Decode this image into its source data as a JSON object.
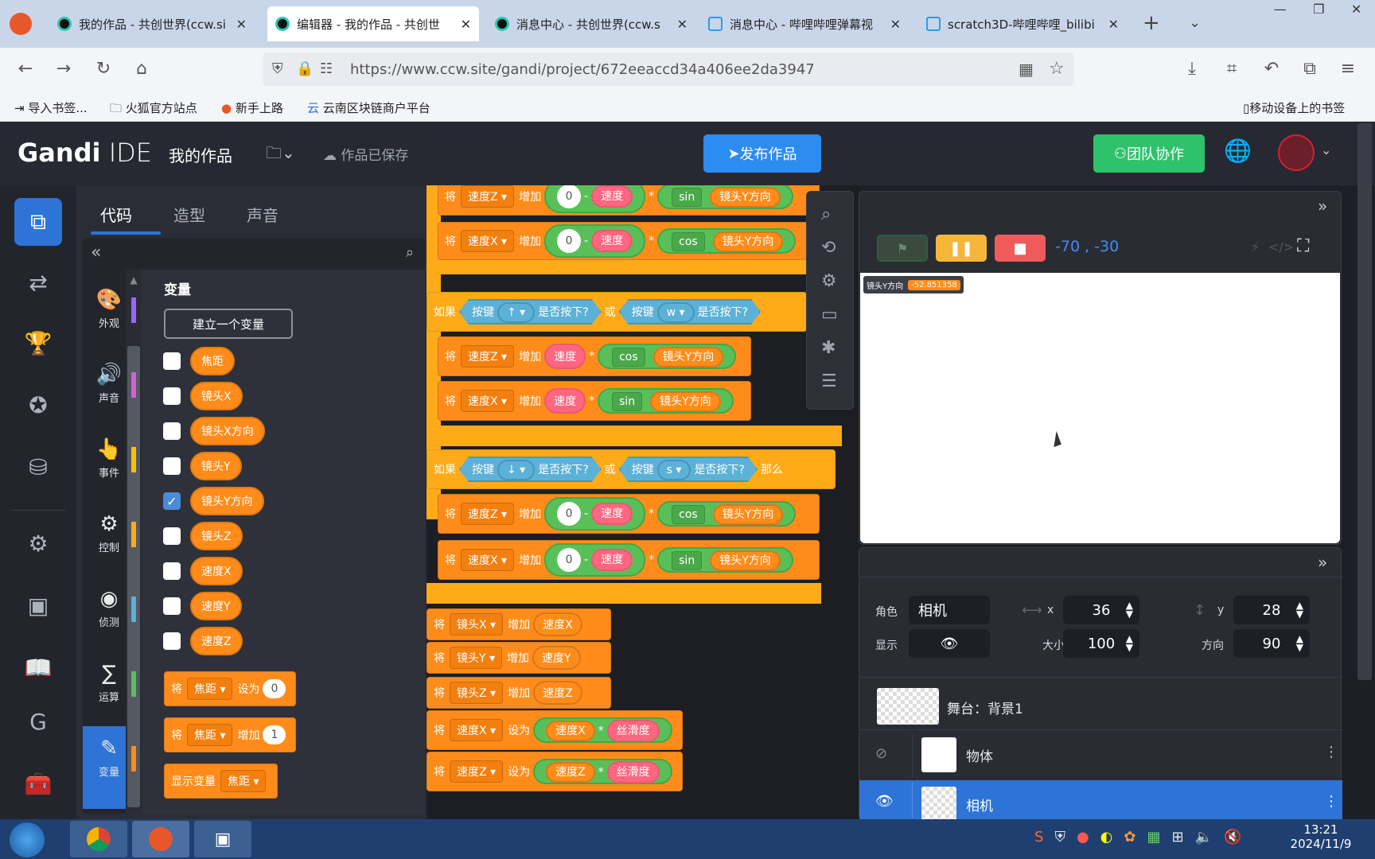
{
  "browser": {
    "tabs": [
      {
        "label": "我的作品 - 共创世界(ccw.si",
        "type": "ccw"
      },
      {
        "label": "编辑器 - 我的作品 - 共创世",
        "type": "ccw",
        "active": true
      },
      {
        "label": "消息中心 - 共创世界(ccw.s",
        "type": "ccw"
      },
      {
        "label": "消息中心 - 哔哩哔哩弹幕视",
        "type": "bili"
      },
      {
        "label": "scratch3D-哔哩哔哩_bilibi",
        "type": "bili"
      }
    ],
    "url": "https://www.ccw.site/gandi/project/672eeaccd34a406ee2da3947",
    "bookmarks": [
      "导入书签...",
      "火狐官方站点",
      "新手上路",
      "云南区块链商户平台"
    ],
    "mobile_bookmarks": "移动设备上的书签"
  },
  "app": {
    "logo_bold": "Gandi",
    "logo_light": "IDE",
    "project_name": "我的作品",
    "save_status": "作品已保存",
    "publish_label": "发布作品",
    "team_label": "团队协作"
  },
  "code_tabs": [
    "代码",
    "造型",
    "声音"
  ],
  "categories": [
    {
      "label": "外观",
      "color": "#9966ff",
      "icon": "palette-icon",
      "glyph": "🎨"
    },
    {
      "label": "声音",
      "color": "#cf63cf",
      "icon": "speaker-icon",
      "glyph": "🔊"
    },
    {
      "label": "事件",
      "color": "#ffbf00",
      "icon": "pointer-icon",
      "glyph": "👆"
    },
    {
      "label": "控制",
      "color": "#ffab19",
      "icon": "flow-icon",
      "glyph": "⚙"
    },
    {
      "label": "侦测",
      "color": "#5cb1d6",
      "icon": "signal-icon",
      "glyph": "◉"
    },
    {
      "label": "运算",
      "color": "#59c059",
      "icon": "math-icon",
      "glyph": "∑"
    },
    {
      "label": "变量",
      "color": "#ff8c1a",
      "icon": "variable-icon",
      "glyph": "✎"
    }
  ],
  "palette": {
    "section_title": "变量",
    "make_variable": "建立一个变量",
    "variables": [
      {
        "name": "焦距",
        "checked": false
      },
      {
        "name": "镜头X",
        "checked": false
      },
      {
        "name": "镜头X方向",
        "checked": false
      },
      {
        "name": "镜头Y",
        "checked": false
      },
      {
        "name": "镜头Y方向",
        "checked": true
      },
      {
        "name": "镜头Z",
        "checked": false
      },
      {
        "name": "速度X",
        "checked": false
      },
      {
        "name": "速度Y",
        "checked": false
      },
      {
        "name": "速度Z",
        "checked": false
      }
    ],
    "blocks": [
      {
        "set": "将",
        "var": "焦距",
        "op": "设为",
        "value": "0"
      },
      {
        "set": "将",
        "var": "焦距",
        "op": "增加",
        "value": "1"
      },
      {
        "set": "显示变量",
        "var": "焦距"
      }
    ]
  },
  "script": {
    "change_z1": {
      "k": "将",
      "v": "速度Z",
      "op": "增加",
      "n": "0",
      "minus": "-",
      "r": "速度",
      "mul": "*",
      "fn": "sin",
      "arg": "镜头Y方向"
    },
    "change_x1": {
      "k": "将",
      "v": "速度X",
      "op": "增加",
      "n": "0",
      "minus": "-",
      "r": "速度",
      "mul": "*",
      "fn": "cos",
      "arg": "镜头Y方向"
    },
    "if1": {
      "k": "如果",
      "key_label": "按键",
      "key1": "↑",
      "pressed": "是否按下?",
      "or": "或",
      "key2": "w"
    },
    "change_z2": {
      "k": "将",
      "v": "速度Z",
      "op": "增加",
      "r": "速度",
      "mul": "*",
      "fn": "cos",
      "arg": "镜头Y方向"
    },
    "change_x2": {
      "k": "将",
      "v": "速度X",
      "op": "增加",
      "r": "速度",
      "mul": "*",
      "fn": "sin",
      "arg": "镜头Y方向"
    },
    "if2": {
      "k": "如果",
      "key_label": "按键",
      "key1": "↓",
      "pressed": "是否按下?",
      "or": "或",
      "key2": "s",
      "then": "那么"
    },
    "change_z3": {
      "k": "将",
      "v": "速度Z",
      "op": "增加",
      "n": "0",
      "minus": "-",
      "r": "速度",
      "mul": "*",
      "fn": "cos",
      "arg": "镜头Y方向"
    },
    "change_x3": {
      "k": "将",
      "v": "速度X",
      "op": "增加",
      "n": "0",
      "minus": "-",
      "r": "速度",
      "mul": "*",
      "fn": "sin",
      "arg": "镜头Y方向"
    },
    "cam_x": {
      "k": "将",
      "v": "镜头X",
      "op": "增加",
      "r": "速度X"
    },
    "cam_y": {
      "k": "将",
      "v": "镜头Y",
      "op": "增加",
      "r": "速度Y"
    },
    "cam_z": {
      "k": "将",
      "v": "镜头Z",
      "op": "增加",
      "r": "速度Z"
    },
    "set_x": {
      "k": "将",
      "v": "速度X",
      "op": "设为",
      "a": "速度X",
      "mul": "*",
      "b": "丝滑度"
    },
    "set_z": {
      "k": "将",
      "v": "速度Z",
      "op": "设为",
      "a": "速度Z",
      "mul": "*",
      "b": "丝滑度"
    }
  },
  "stage": {
    "coords": "-70 , -30",
    "monitor_label": "镜头Y方向",
    "monitor_value": "-52.851358"
  },
  "sprite": {
    "role_label": "角色",
    "role_name": "相机",
    "x_label": "x",
    "x": "36",
    "y_label": "y",
    "y": "28",
    "show_label": "显示",
    "size_label": "大小",
    "size": "100",
    "dir_label": "方向",
    "direction": "90",
    "stage_label": "舞台：背景1",
    "sprites": [
      {
        "name": "物体"
      },
      {
        "name": "相机",
        "selected": true
      }
    ]
  },
  "taskbar": {
    "time": "13:21",
    "date": "2024/11/9"
  }
}
